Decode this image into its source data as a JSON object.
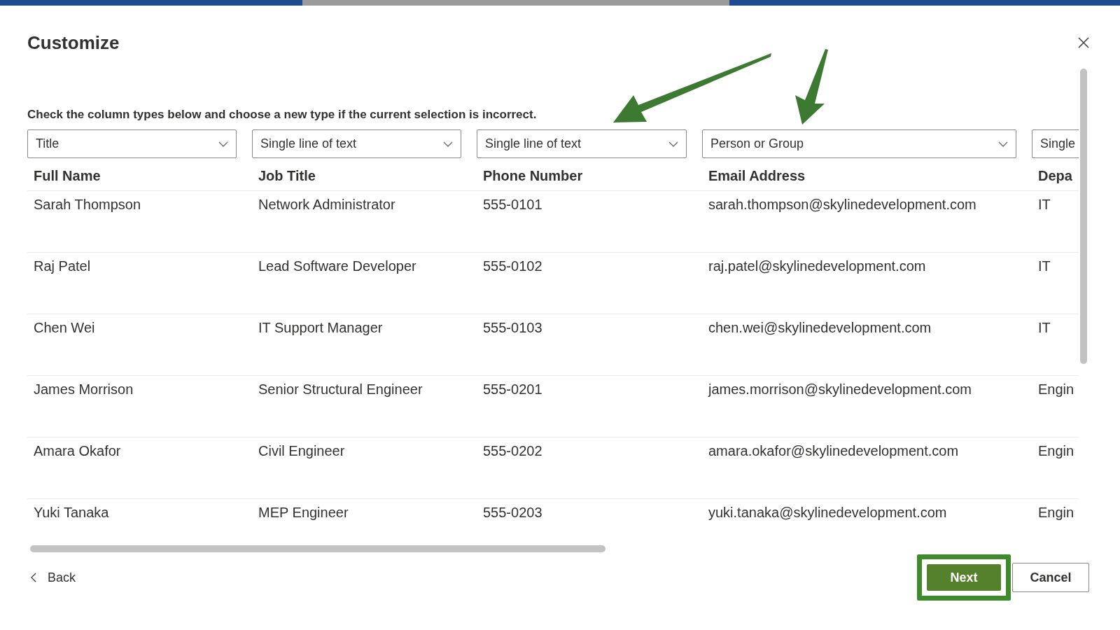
{
  "dialog": {
    "title": "Customize",
    "instruction": "Check the column types below and choose a new type if the current selection is incorrect."
  },
  "columns": [
    {
      "type": "Title",
      "header": "Full Name"
    },
    {
      "type": "Single line of text",
      "header": "Job Title"
    },
    {
      "type": "Single line of text",
      "header": "Phone Number"
    },
    {
      "type": "Person or Group",
      "header": "Email Address"
    },
    {
      "type": "Single",
      "header": "Depa"
    }
  ],
  "rows": [
    [
      "Sarah Thompson",
      "Network Administrator",
      "555-0101",
      "sarah.thompson@skylinedevelopment.com",
      "IT"
    ],
    [
      "Raj Patel",
      "Lead Software Developer",
      "555-0102",
      "raj.patel@skylinedevelopment.com",
      "IT"
    ],
    [
      "Chen Wei",
      "IT Support Manager",
      "555-0103",
      "chen.wei@skylinedevelopment.com",
      "IT"
    ],
    [
      "James Morrison",
      "Senior Structural Engineer",
      "555-0201",
      "james.morrison@skylinedevelopment.com",
      "Engin"
    ],
    [
      "Amara Okafor",
      "Civil Engineer",
      "555-0202",
      "amara.okafor@skylinedevelopment.com",
      "Engin"
    ],
    [
      "Yuki Tanaka",
      "MEP Engineer",
      "555-0203",
      "yuki.tanaka@skylinedevelopment.com",
      "Engin"
    ]
  ],
  "footer": {
    "back": "Back",
    "next": "Next",
    "cancel": "Cancel"
  }
}
